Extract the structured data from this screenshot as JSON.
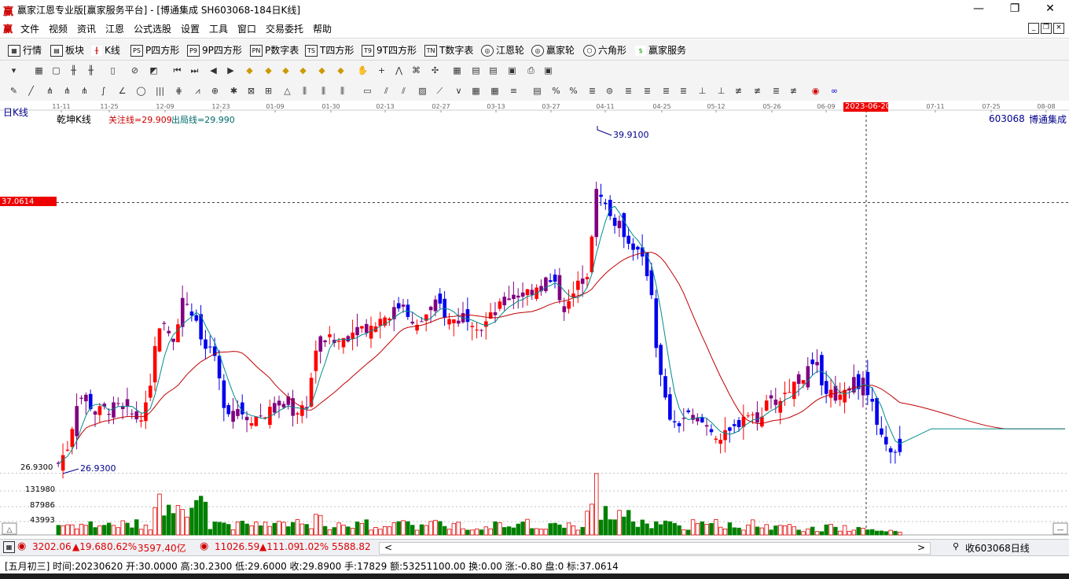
{
  "window": {
    "app_logo": "赢",
    "title": "赢家江恩专业版[赢家服务平台] - [博通集成  SH603068-184日K线]",
    "controls": {
      "minimize": "—",
      "maximize": "❐",
      "close": "✕"
    }
  },
  "menu": {
    "logo": "赢",
    "items": [
      "文件",
      "视频",
      "资讯",
      "江恩",
      "公式选股",
      "设置",
      "工具",
      "窗口",
      "交易委托",
      "帮助"
    ]
  },
  "nav": {
    "items": [
      {
        "label": "行情",
        "icon": "grid-icon"
      },
      {
        "label": "板块",
        "icon": "blocks-icon"
      },
      {
        "label": "K线",
        "icon": "candles-icon"
      },
      {
        "label": "P四方形",
        "icon": "PS"
      },
      {
        "label": "9P四方形",
        "icon": "P9"
      },
      {
        "label": "P数字表",
        "icon": "PN"
      },
      {
        "label": "T四方形",
        "icon": "TS"
      },
      {
        "label": "9T四方形",
        "icon": "T9"
      },
      {
        "label": "T数字表",
        "icon": "TN"
      },
      {
        "label": "江恩轮",
        "icon": "wheel-icon"
      },
      {
        "label": "赢家轮",
        "icon": "wheel-icon"
      },
      {
        "label": "六角形",
        "icon": "hexagon-icon"
      },
      {
        "label": "赢家服务",
        "icon": "dollar-icon"
      }
    ]
  },
  "chart_header": {
    "period_label": "日K线",
    "indicator_name": "乾坤K线",
    "focus_line": "关注线=29.909",
    "exit_line": "出局线=29.990",
    "stock_code": "603068",
    "stock_name": "博通集成",
    "price_line_label": "37.0614",
    "selected_date": "2023-06-20",
    "high_label": "39.9100",
    "low_label": "26.9300",
    "low_axis": "26.9300"
  },
  "date_ticks": [
    "11-11",
    "11-25",
    "12-09",
    "12-23",
    "01-09",
    "01-30",
    "02-13",
    "02-27",
    "03-13",
    "03-27",
    "04-11",
    "04-25",
    "05-12",
    "05-26",
    "06-09",
    "07-11",
    "07-25",
    "08-08"
  ],
  "volume_axis": [
    "131980",
    "87986",
    "43993"
  ],
  "chart_data": {
    "type": "candlestick",
    "price_range": [
      26.93,
      39.91
    ],
    "series": [
      {
        "name": "关注线",
        "value": 29.909
      },
      {
        "name": "出局线",
        "value": 29.99
      }
    ],
    "marks": {
      "high": 39.91,
      "low": 26.93,
      "cursor_price": 37.0614
    },
    "volume_ticks": [
      131980,
      87986,
      43993
    ]
  },
  "status": {
    "sh_index": "3202.06",
    "sh_change": "▲19.68",
    "sh_pct": "0.62%",
    "sh_amount": "3597.40亿",
    "sz_index": "11026.59",
    "sz_change": "▲111.09",
    "sz_pct": "1.02%",
    "sz_amount": "5588.82",
    "right_label": "收603068日线",
    "scroll_left": "<",
    "scroll_right": ">"
  },
  "info": {
    "text": "[五月初三] 时间:20230620 开:30.0000 高:30.2300 低:29.6000 收:29.8900 手:17829 额:53251100.00 换:0.00 涨:-0.80 盘:0 标:37.0614"
  },
  "colors": {
    "up": "#ff0000",
    "down": "#0000ee",
    "purple": "#800080",
    "ma_short": "#008b8b",
    "ma_long": "#c00000",
    "volume_green": "#008000"
  }
}
